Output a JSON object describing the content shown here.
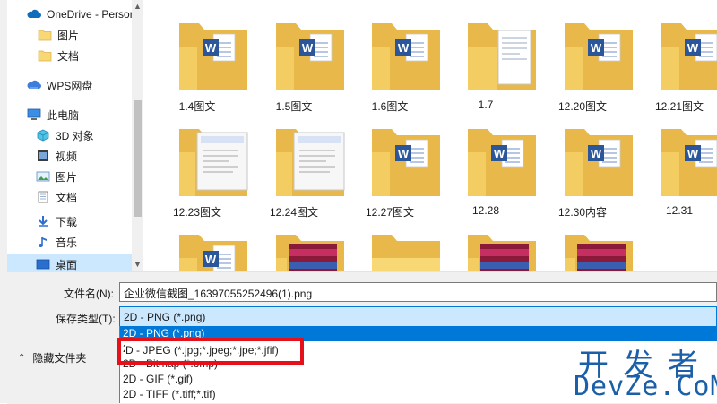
{
  "nav": {
    "items": [
      {
        "label": "OneDrive - Personal",
        "icon": "onedrive-cloud-icon"
      },
      {
        "label": "图片",
        "icon": "folder-icon"
      },
      {
        "label": "文档",
        "icon": "folder-icon"
      },
      {
        "label": "WPS网盘",
        "icon": "wps-cloud-icon"
      },
      {
        "label": "此电脑",
        "icon": "computer-icon"
      },
      {
        "label": "3D 对象",
        "icon": "3d-objects-icon"
      },
      {
        "label": "视频",
        "icon": "video-icon"
      },
      {
        "label": "图片",
        "icon": "pictures-icon"
      },
      {
        "label": "文档",
        "icon": "documents-icon"
      },
      {
        "label": "下载",
        "icon": "download-arrow-icon"
      },
      {
        "label": "音乐",
        "icon": "music-note-icon"
      },
      {
        "label": "桌面",
        "icon": "desktop-icon"
      }
    ]
  },
  "files": [
    {
      "label": "1.4图文",
      "type": "word-folder"
    },
    {
      "label": "1.5图文",
      "type": "word-folder"
    },
    {
      "label": "1.6图文",
      "type": "word-folder"
    },
    {
      "label": "1.7",
      "type": "doc-folder"
    },
    {
      "label": "12.20图文",
      "type": "word-folder"
    },
    {
      "label": "12.21图文",
      "type": "word-folder"
    },
    {
      "label": "12.23图文",
      "type": "screenshot-folder"
    },
    {
      "label": "12.24图文",
      "type": "screenshot-folder"
    },
    {
      "label": "12.27图文",
      "type": "word-folder"
    },
    {
      "label": "12.28",
      "type": "word-folder"
    },
    {
      "label": "12.30内容",
      "type": "word-folder"
    },
    {
      "label": "12.31",
      "type": "word-folder"
    },
    {
      "label": "",
      "type": "word-folder"
    },
    {
      "label": "",
      "type": "archive-folder"
    },
    {
      "label": "",
      "type": "plain-folder"
    },
    {
      "label": "",
      "type": "archive-folder"
    },
    {
      "label": "",
      "type": "archive-folder"
    }
  ],
  "form": {
    "filename_label": "文件名(N):",
    "filename_value": "企业微信截图_16397055252496(1).png",
    "type_label": "保存类型(T):",
    "type_value": "2D - PNG (*.png)"
  },
  "dropdown": {
    "options": [
      "2D - PNG (*.png)",
      "2D - JPEG (*.jpg;*.jpeg;*.jpe;*.jfif)",
      "2D - Bitmap (*.bmp)",
      "2D - GIF (*.gif)",
      "2D - TIFF (*.tiff;*.tif)"
    ],
    "highlighted_text": "D - JPEG (*.jpg;*.jpeg;*.jpe;*.jfif)"
  },
  "hide_folders_label": "隐藏文件夹",
  "watermark": {
    "cn": "开发者",
    "en": "DevZe.CoM"
  },
  "colors": {
    "selection": "#cce8ff",
    "highlight": "#0078d7",
    "annotation": "#e5101a",
    "folder": "#f8d775",
    "word": "#2b579a"
  }
}
